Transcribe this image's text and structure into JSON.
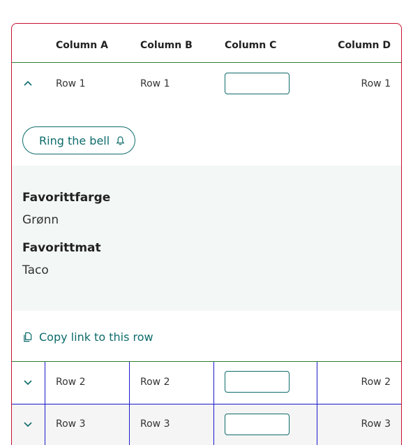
{
  "table": {
    "headers": [
      "Column A",
      "Column B",
      "Column C",
      "Column D"
    ],
    "rows": [
      {
        "a": "Row 1",
        "b": "Row 1",
        "c_value": "",
        "d": "Row 1",
        "expanded": true
      },
      {
        "a": "Row 2",
        "b": "Row 2",
        "c_value": "",
        "d": "Row 2",
        "expanded": false
      },
      {
        "a": "Row 3",
        "b": "Row 3",
        "c_value": "",
        "d": "Row 3",
        "expanded": false
      }
    ]
  },
  "expanded": {
    "button_label": "Ring the bell",
    "details": [
      {
        "term": "Favorittfarge",
        "value": "Grønn"
      },
      {
        "term": "Favorittmat",
        "value": "Taco"
      }
    ],
    "copy_link_label": "Copy link to this row"
  },
  "icons": {
    "collapse": "chevron-up-icon",
    "expand": "chevron-down-icon",
    "bell": "bell-icon",
    "copy": "copy-icon"
  },
  "colors": {
    "accent": "#0e6b6b",
    "table_border": "#c8102e",
    "row_divider": "#2e7d32",
    "cell_divider": "#1a1acc",
    "details_bg": "#f3f8f7"
  }
}
